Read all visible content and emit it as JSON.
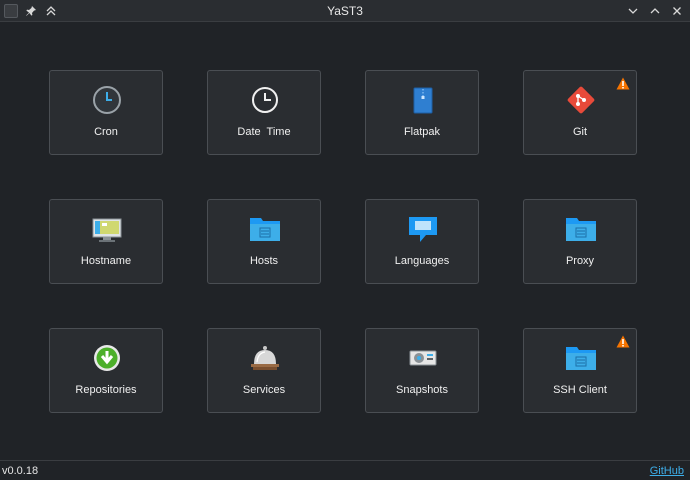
{
  "window": {
    "title": "YaST3"
  },
  "tiles": [
    {
      "label": "Cron",
      "icon": "clock-icon",
      "warning": false
    },
    {
      "label": "Date  Time",
      "icon": "clock-white-icon",
      "warning": false
    },
    {
      "label": "Flatpak",
      "icon": "package-icon",
      "warning": false
    },
    {
      "label": "Git",
      "icon": "git-icon",
      "warning": true
    },
    {
      "label": "Hostname",
      "icon": "computer-icon",
      "warning": false
    },
    {
      "label": "Hosts",
      "icon": "folder-icon",
      "warning": false
    },
    {
      "label": "Languages",
      "icon": "chat-bubble-icon",
      "warning": false
    },
    {
      "label": "Proxy",
      "icon": "folder-icon",
      "warning": false
    },
    {
      "label": "Repositories",
      "icon": "download-icon",
      "warning": false
    },
    {
      "label": "Services",
      "icon": "service-bell-icon",
      "warning": false
    },
    {
      "label": "Snapshots",
      "icon": "disk-icon",
      "warning": false
    },
    {
      "label": "SSH Client",
      "icon": "folder-icon",
      "warning": true
    }
  ],
  "status": {
    "version": "v0.0.18",
    "link": "GitHub"
  },
  "colors": {
    "background": "#202327",
    "tile": "#2a2d31",
    "tile_border": "#4a4e53",
    "accent": "#3daee9",
    "warning": "#f67400",
    "git": "#e84a3a",
    "folder": "#3daee9"
  }
}
